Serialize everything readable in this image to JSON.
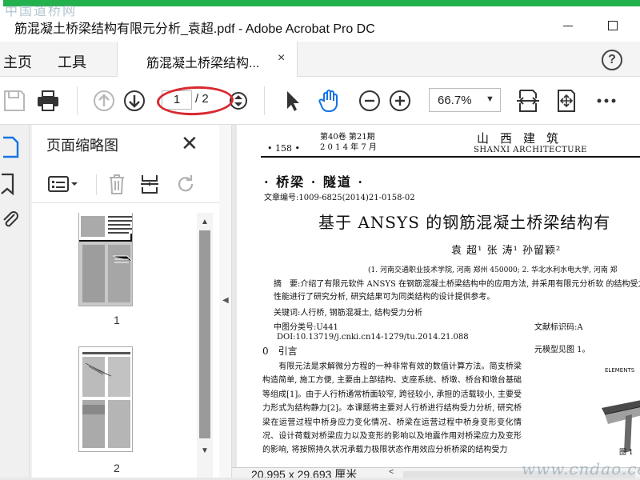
{
  "watermarks": {
    "top": "中国道桥网",
    "bottom": "www.cndao.com"
  },
  "window": {
    "title": "筋混凝土桥梁结构有限元分析_袁超.pdf - Adobe Acrobat Pro DC",
    "minimize_icon": "minimize-icon",
    "maximize_icon": "maximize-icon"
  },
  "tabs": {
    "home": "主页",
    "tools": "工具",
    "document": "筋混凝土桥梁结构...",
    "close": "×",
    "help": "?"
  },
  "toolbar": {
    "current_page": "1",
    "total_pages": "/ 2",
    "zoom": "66.7%",
    "zoom_arrow": "▼",
    "icons": [
      "save-icon",
      "print-icon",
      "previous-page-icon",
      "next-page-icon",
      "page-stepper-icon",
      "select-cursor-icon",
      "hand-tool-icon",
      "zoom-out-icon",
      "zoom-in-icon",
      "fit-page-icon",
      "full-screen-icon",
      "more-icon"
    ],
    "annotation_color": "#d9282f"
  },
  "left_panel": {
    "title": "页面缩略图",
    "close": "✕",
    "icons": [
      "bookmark-panel-icon",
      "bookmarks-icon",
      "attachments-icon",
      "thumbnail-options-icon",
      "delete-page-icon",
      "extract-page-icon",
      "rotate-icon"
    ],
    "thumbnails": [
      {
        "label": "1"
      },
      {
        "label": "2"
      }
    ],
    "scroll_up": "▲",
    "scroll_down": "▼",
    "collapse_arrow": "◀"
  },
  "document": {
    "page_number": "• 158 •",
    "volume": "第40卷 第21期",
    "date": "2 0 1 4 年 7 月",
    "journal": "山西建筑",
    "journal_en": "SHANXI  ARCHITECTURE",
    "column": "· 桥梁 · 隧道 ·",
    "article_no": "文章编号:1009-6825(2014)21-0158-02",
    "title": "基于 ANSYS 的钢筋混凝土桥梁结构有",
    "authors": "袁 超¹   张 涛¹   孙留颖²",
    "affiliation": "(1. 河南交通职业技术学院, 河南 郑州  450000; 2. 华北水利水电大学, 河南 郑",
    "abstract_label": "摘　要:",
    "abstract": "介绍了有限元软件 ANSYS 在钢筋混凝土桥梁结构中的应用方法, 并采用有限元分析软 的结构受力性能进行了研究分析, 研究结果可为同类结构的设计提供参考。",
    "keywords": "关键词:人行桥, 钢筋混凝土, 结构受力分析",
    "clc": "中图分类号:U441",
    "doc_id": "文献标识码:A",
    "doi": "DOI:10.13719/j.cnki.cn14-1279/tu.2014.21.088",
    "section": "0　引言",
    "right_snippet": "元模型见图 1。",
    "body": "　　有限元法是求解微分方程的一种非常有效的数值计算方法。简支桥梁构造简单, 施工方便, 主要由上部结构、支座系统、桥墩、桥台和墩台基础等组成[1]。由于人行桥通常桥面较窄, 跨径较小, 承担的活载较小, 主要受力形式为结构静力[2]。本课题将主要对人行桥进行结构受力分析, 研究桥梁在运营过程中桥身应力变化情况、桥梁在运营过程中桥身变形变化情况、设计荷载对桥梁应力以及变形的影响以及地震作用对桥梁应力及变形的影响, 将按照持久状况承载力极限状态作用效应分析桥梁的结构受力",
    "figure_label": "ELEMENTS",
    "figure_caption": "图 1"
  },
  "statusbar": {
    "page_size": "20.995 x 29.693 厘米",
    "arrow": "<"
  }
}
